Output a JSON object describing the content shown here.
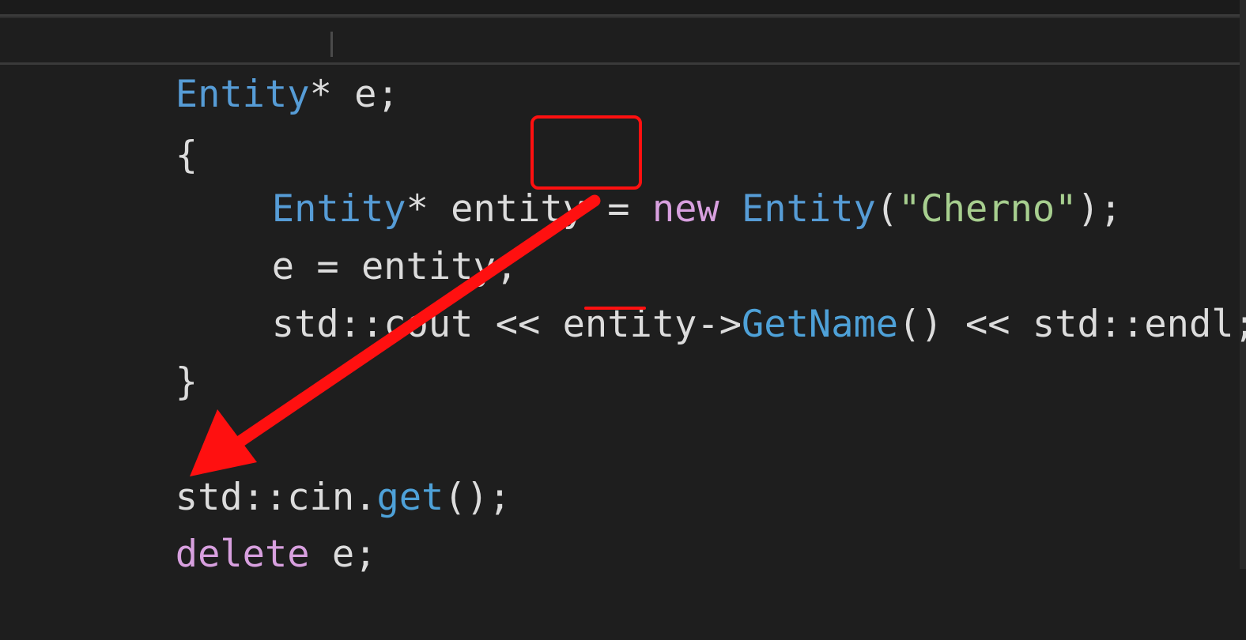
{
  "editor": {
    "lines": [
      {
        "parts": [
          [
            "Entity",
            "type"
          ],
          [
            "* e;",
            "plain"
          ]
        ]
      },
      {
        "parts": [
          [
            "{",
            "plain"
          ]
        ]
      },
      {
        "parts": [
          [
            "Entity",
            "type"
          ],
          [
            "* entity = ",
            "plain"
          ],
          [
            "new",
            "kw"
          ],
          [
            " ",
            "plain"
          ],
          [
            "Entity",
            "type"
          ],
          [
            "(",
            "plain"
          ],
          [
            "\"Cherno\"",
            "str"
          ],
          [
            ");",
            "plain"
          ]
        ]
      },
      {
        "parts": [
          [
            "e = entity;",
            "plain"
          ]
        ]
      },
      {
        "parts": [
          [
            "std::cout << entity->",
            "plain"
          ],
          [
            "GetName",
            "fn"
          ],
          [
            "() << std::endl;",
            "plain"
          ]
        ]
      },
      {
        "parts": [
          [
            "}",
            "plain"
          ]
        ]
      },
      {
        "parts": [
          [
            "",
            "plain"
          ]
        ]
      },
      {
        "parts": [
          [
            "std::cin.",
            "plain"
          ],
          [
            "get",
            "fn"
          ],
          [
            "();",
            "plain"
          ]
        ]
      },
      {
        "parts": [
          [
            "delete",
            "kw"
          ],
          [
            " e;",
            "plain"
          ]
        ]
      }
    ]
  },
  "colors": {
    "background": "#1e1e1e",
    "type": "#569cd6",
    "keyword": "#d8a0df",
    "string": "#a7cf8f",
    "annotation": "#ff1010"
  },
  "annotations": {
    "box_icon": "red-rectangle-highlight",
    "arrow_icon": "red-arrow",
    "underline_icon": "red-underline"
  }
}
